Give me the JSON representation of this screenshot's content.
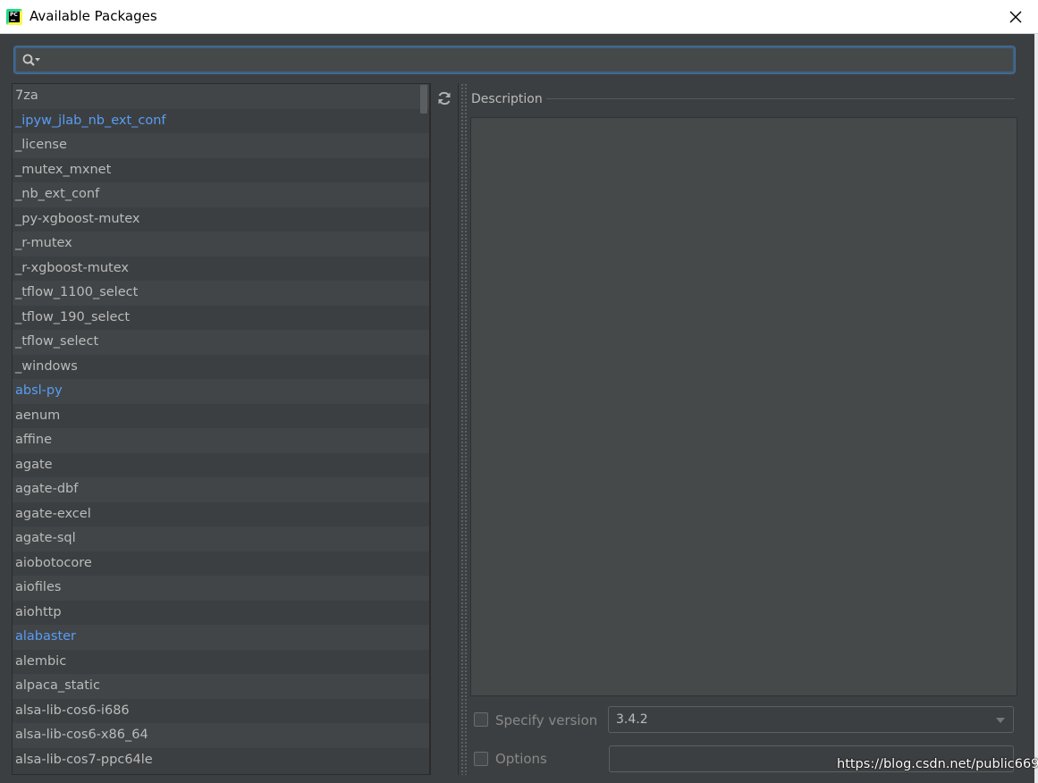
{
  "window": {
    "title": "Available Packages",
    "app_icon_text": "PC"
  },
  "search": {
    "value": "",
    "placeholder": ""
  },
  "packages": [
    {
      "name": "7za",
      "highlighted": false
    },
    {
      "name": "_ipyw_jlab_nb_ext_conf",
      "highlighted": true
    },
    {
      "name": "_license",
      "highlighted": false
    },
    {
      "name": "_mutex_mxnet",
      "highlighted": false
    },
    {
      "name": "_nb_ext_conf",
      "highlighted": false
    },
    {
      "name": "_py-xgboost-mutex",
      "highlighted": false
    },
    {
      "name": "_r-mutex",
      "highlighted": false
    },
    {
      "name": "_r-xgboost-mutex",
      "highlighted": false
    },
    {
      "name": "_tflow_1100_select",
      "highlighted": false
    },
    {
      "name": "_tflow_190_select",
      "highlighted": false
    },
    {
      "name": "_tflow_select",
      "highlighted": false
    },
    {
      "name": "_windows",
      "highlighted": false
    },
    {
      "name": "absl-py",
      "highlighted": true
    },
    {
      "name": "aenum",
      "highlighted": false
    },
    {
      "name": "affine",
      "highlighted": false
    },
    {
      "name": "agate",
      "highlighted": false
    },
    {
      "name": "agate-dbf",
      "highlighted": false
    },
    {
      "name": "agate-excel",
      "highlighted": false
    },
    {
      "name": "agate-sql",
      "highlighted": false
    },
    {
      "name": "aiobotocore",
      "highlighted": false
    },
    {
      "name": "aiofiles",
      "highlighted": false
    },
    {
      "name": "aiohttp",
      "highlighted": false
    },
    {
      "name": "alabaster",
      "highlighted": true
    },
    {
      "name": "alembic",
      "highlighted": false
    },
    {
      "name": "alpaca_static",
      "highlighted": false
    },
    {
      "name": "alsa-lib-cos6-i686",
      "highlighted": false
    },
    {
      "name": "alsa-lib-cos6-x86_64",
      "highlighted": false
    },
    {
      "name": "alsa-lib-cos7-ppc64le",
      "highlighted": false
    }
  ],
  "description": {
    "label": "Description",
    "text": ""
  },
  "specify_version": {
    "label": "Specify version",
    "checked": false,
    "value": "3.4.2"
  },
  "options": {
    "label": "Options",
    "checked": false,
    "value": ""
  },
  "watermark": "https://blog.csdn.net/public669",
  "colors": {
    "highlight_text": "#589df6",
    "text": "#bbbbbb",
    "background": "#3c3f41"
  }
}
